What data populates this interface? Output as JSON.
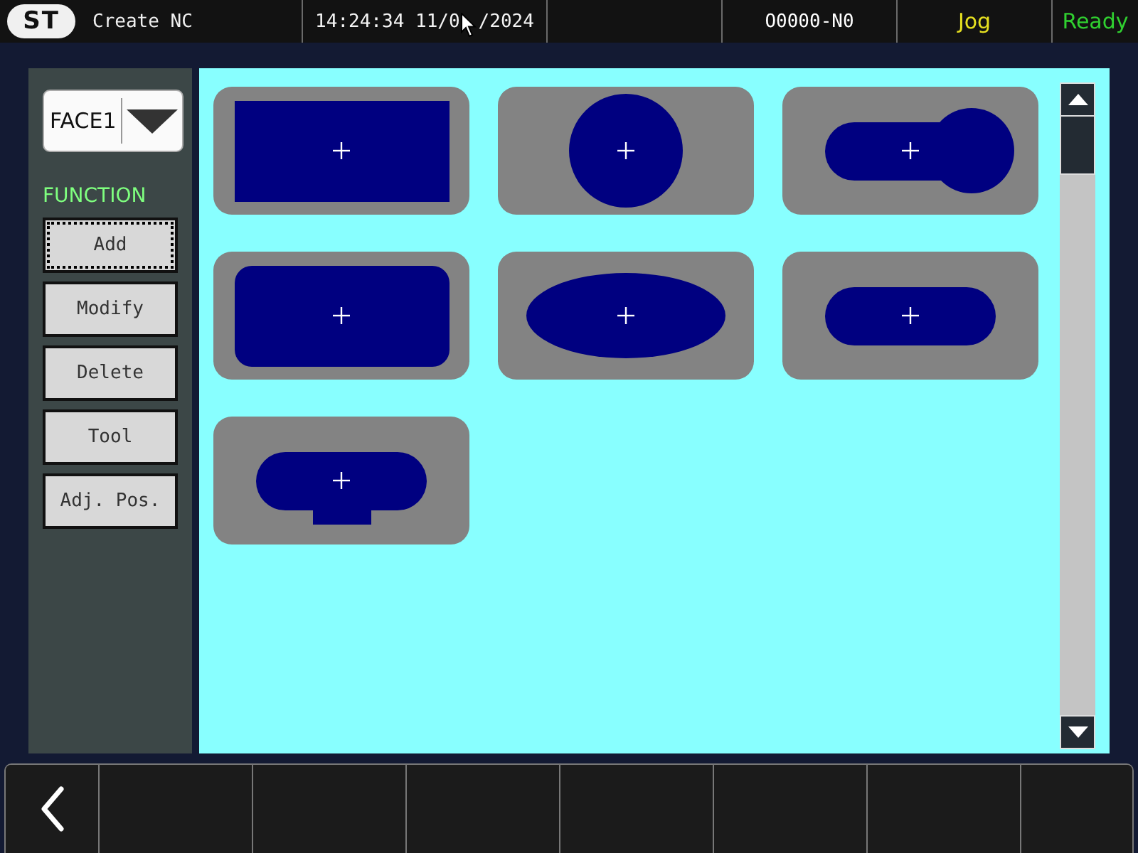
{
  "header": {
    "logo": "ST",
    "title": "Create NC",
    "clock": {
      "parts": [
        "14:24:34 11/0",
        "/2024"
      ]
    },
    "cells": [
      {
        "text": "O0000-N0",
        "color": "#ffffff"
      },
      {
        "text": "Jog",
        "color": "#e6e020"
      },
      {
        "text": "Ready",
        "color": "#30d030"
      }
    ]
  },
  "face_select": {
    "value": "FACE1"
  },
  "function_panel": {
    "label": "FUNCTION",
    "buttons": [
      {
        "label": "Add",
        "focused": true
      },
      {
        "label": "Modify",
        "focused": false
      },
      {
        "label": "Delete",
        "focused": false
      },
      {
        "label": "Tool",
        "focused": false
      },
      {
        "label": "Adj. Pos.",
        "focused": false
      }
    ]
  },
  "shapes": [
    {
      "kind": "rectangle"
    },
    {
      "kind": "circle"
    },
    {
      "kind": "keyhole"
    },
    {
      "kind": "rounded-rectangle"
    },
    {
      "kind": "ellipse"
    },
    {
      "kind": "slot"
    },
    {
      "kind": "slot-with-tab"
    }
  ],
  "softkeys": [
    {
      "kind": "back"
    },
    {
      "kind": "blank"
    },
    {
      "kind": "blank"
    },
    {
      "kind": "blank"
    },
    {
      "kind": "blank"
    },
    {
      "kind": "blank"
    },
    {
      "kind": "blank"
    },
    {
      "kind": "blank"
    }
  ]
}
